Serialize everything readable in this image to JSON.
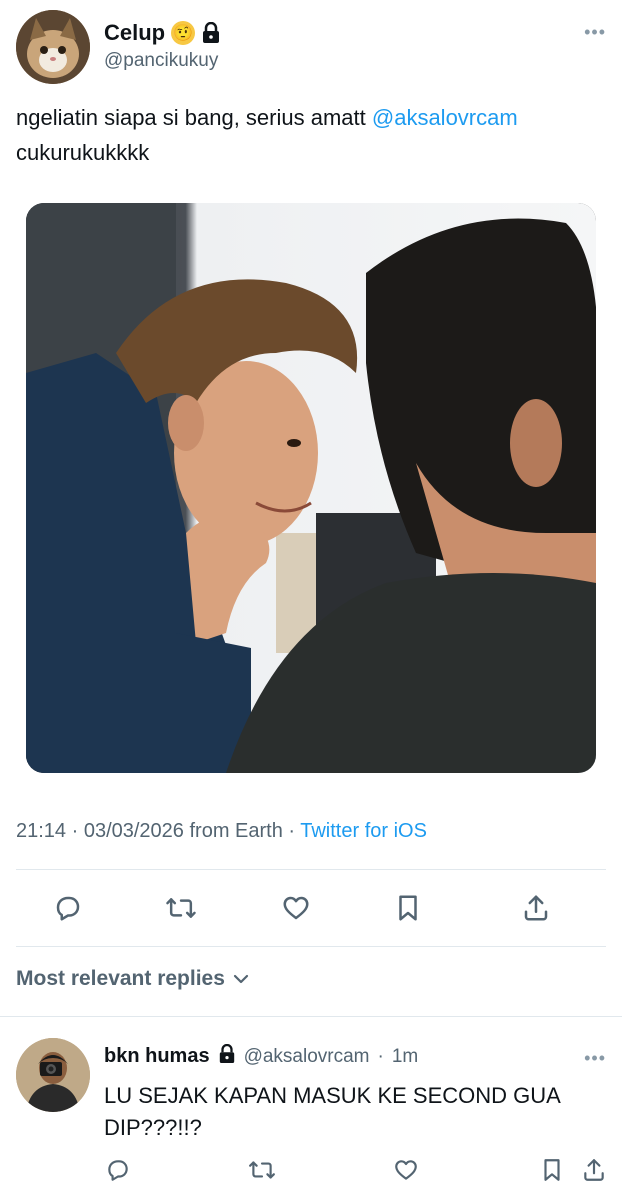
{
  "tweet": {
    "author": {
      "name": "Celup",
      "handle": "@pancikukuy",
      "emoji": "🤨"
    },
    "more_label": "•••",
    "text_before": "ngeliatin siapa si bang, serius amatt ",
    "mention": "@aksalovrcam",
    "text_after": " cukurukukkkk",
    "timestamp": "21:14 · 03/03/2026 from Earth · ",
    "source": "Twitter for iOS",
    "actions": [
      "reply-icon",
      "retweet-icon",
      "like-icon",
      "bookmark-icon",
      "share-icon"
    ]
  },
  "replies_filter": {
    "label": "Most relevant replies"
  },
  "reply": {
    "name": "bkn humas",
    "handle": "@aksalovrcam",
    "dot": "·",
    "time": "1m",
    "more_label": "•••",
    "text": "LU SEJAK KAPAN MASUK KE SECOND GUA DIP???!!?"
  },
  "colors": {
    "accent": "#1d9bf0",
    "secondary_text": "#536471",
    "divider": "#e1e8ed"
  }
}
